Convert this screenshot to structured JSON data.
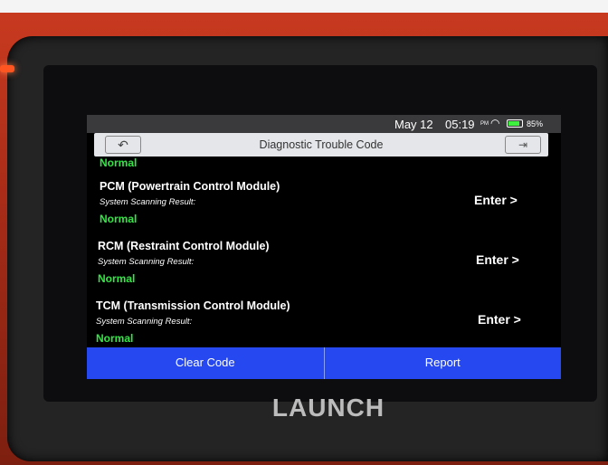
{
  "status_bar": {
    "date": "May 12",
    "time": "05:19",
    "ampm": "PM",
    "wifi_icon": "wifi-icon",
    "battery_percent": "85%"
  },
  "header": {
    "title": "Diagnostic Trouble Code",
    "back_icon": "back-arrow-icon",
    "exit_icon": "exit-icon"
  },
  "list": {
    "partial_status": "Normal",
    "modules": [
      {
        "name": "PCM (Powertrain Control Module)",
        "result_label": "System Scanning Result:",
        "status": "Normal",
        "action": "Enter >"
      },
      {
        "name": "RCM (Restraint Control Module)",
        "result_label": "System Scanning Result:",
        "status": "Normal",
        "action": "Enter >"
      },
      {
        "name": "TCM (Transmission Control Module)",
        "result_label": "System Scanning Result:",
        "status": "Normal",
        "action": "Enter >"
      }
    ]
  },
  "footer": {
    "clear_label": "Clear Code",
    "report_label": "Report"
  },
  "device": {
    "brand": "LAUNCH"
  },
  "colors": {
    "status_green": "#33e645",
    "footer_blue": "#2548f0",
    "bezel_red": "#a92c18"
  }
}
